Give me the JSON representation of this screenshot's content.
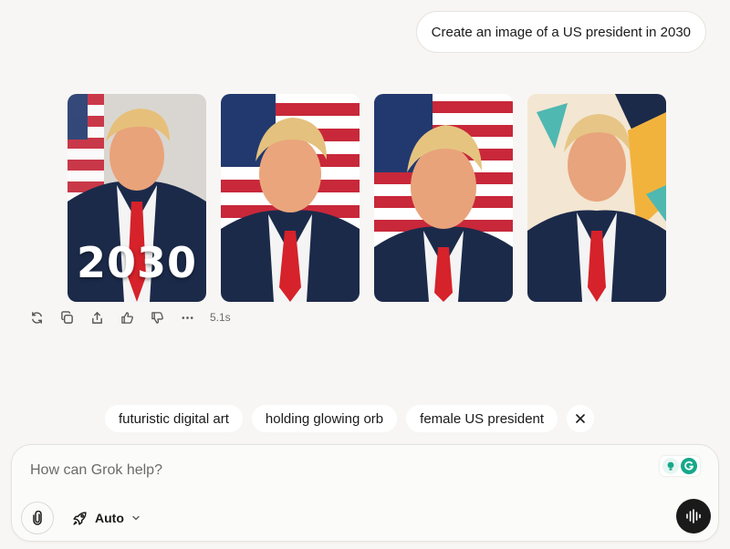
{
  "conversation": {
    "user_message": "Create an image of a US president in 2030",
    "images": [
      {
        "label": "generated-image-1",
        "overlay_text": "2030"
      },
      {
        "label": "generated-image-2",
        "overlay_text": ""
      },
      {
        "label": "generated-image-3",
        "overlay_text": ""
      },
      {
        "label": "generated-image-4",
        "overlay_text": ""
      }
    ],
    "response_time": "5.1s"
  },
  "suggestions": [
    "futuristic digital art",
    "holding glowing orb",
    "female US president"
  ],
  "composer": {
    "placeholder": "How can Grok help?",
    "mode_label": "Auto"
  },
  "icons": {
    "actions": [
      "regenerate-icon",
      "copy-icon",
      "share-icon",
      "thumbs-up-icon",
      "thumbs-down-icon",
      "more-icon"
    ],
    "close": "close-icon",
    "attach": "paperclip-icon",
    "mode": "rocket-icon",
    "voice": "voice-waveform-icon"
  },
  "colors": {
    "background": "#f7f6f4",
    "suit_navy": "#1c2a4a",
    "tie_red": "#d6222a",
    "flag_red": "#c8283a",
    "flag_blue": "#22396f",
    "grammarly_green": "#15a88a"
  }
}
